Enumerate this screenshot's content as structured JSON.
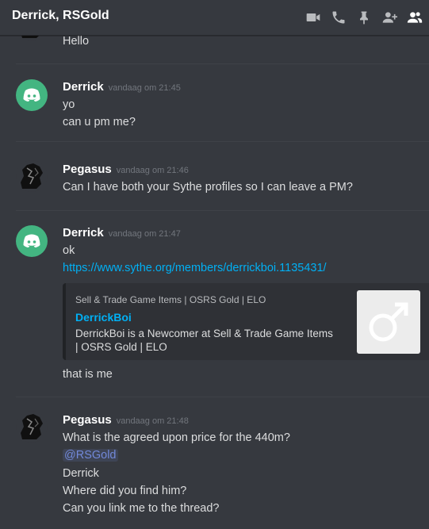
{
  "header": {
    "title": "Derrick, RSGold",
    "icons": [
      "video-call-icon",
      "voice-call-icon",
      "pin-icon",
      "add-friend-icon",
      "members-icon"
    ]
  },
  "messages": {
    "m0": {
      "text": "Hello"
    },
    "m1": {
      "author": "Derrick",
      "timestamp": "vandaag om 21:45",
      "lines": [
        "yo",
        "can u pm me?"
      ]
    },
    "m2": {
      "author": "Pegasus",
      "timestamp": "vandaag om 21:46",
      "lines": [
        "Can I have both your Sythe profiles so I can leave a PM?"
      ]
    },
    "m3": {
      "author": "Derrick",
      "timestamp": "vandaag om 21:47",
      "lines": [
        "ok"
      ],
      "link": "https://www.sythe.org/members/derrickboi.1135431/",
      "embed": {
        "provider": "Sell & Trade Game Items | OSRS Gold | ELO",
        "title": "DerrickBoi",
        "description": "DerrickBoi is a Newcomer at Sell & Trade Game Items | OSRS Gold | ELO"
      },
      "after": "that is me"
    },
    "m4": {
      "author": "Pegasus",
      "timestamp": "vandaag om 21:48",
      "lines": [
        "What is the agreed upon price for the 440m?",
        "Derrick",
        "Where did you find him?",
        "Can you link me to the thread?"
      ],
      "mention": "@RSGold"
    }
  },
  "colors": {
    "background": "#36393f",
    "discord_avatar": "#43b581",
    "link": "#00b0f4",
    "mention": "#7289da"
  }
}
